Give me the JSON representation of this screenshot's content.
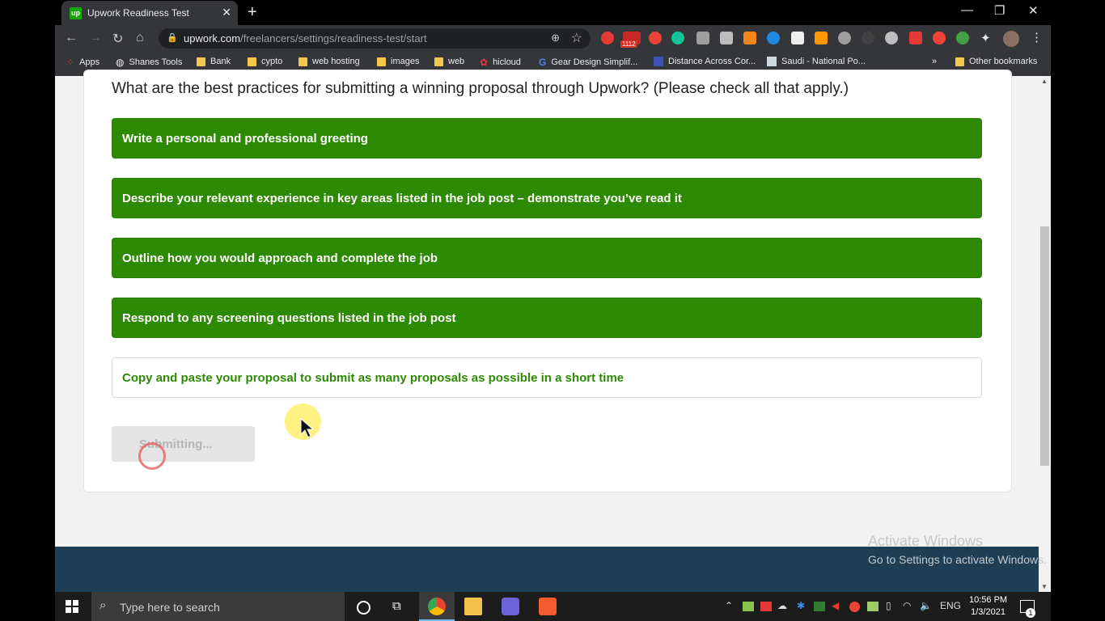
{
  "browser": {
    "tab_title": "Upwork Readiness Test",
    "tab_favicon": "up",
    "url_domain": "upwork.com",
    "url_path": "/freelancers/settings/readiness-test/start",
    "new_tab": "+",
    "bookmarks": [
      {
        "label": "Apps",
        "icon": "apps-grid-icon"
      },
      {
        "label": "Shanes Tools",
        "icon": "globe-icon"
      },
      {
        "label": "Bank",
        "icon": "folder-icon"
      },
      {
        "label": "cypto",
        "icon": "folder-icon"
      },
      {
        "label": "web hosting",
        "icon": "folder-icon"
      },
      {
        "label": "images",
        "icon": "folder-icon"
      },
      {
        "label": "web",
        "icon": "folder-icon"
      },
      {
        "label": "hicloud",
        "icon": "huawei-icon"
      },
      {
        "label": "Gear Design Simplif...",
        "icon": "google-icon"
      },
      {
        "label": "Distance Across Cor...",
        "icon": "page-icon"
      },
      {
        "label": "Saudi - National Po...",
        "icon": "page-icon"
      }
    ],
    "more_bookmarks": "»",
    "other_bookmarks": "Other bookmarks",
    "extension_badge": "1112"
  },
  "question": {
    "text": "What are the best practices for submitting a winning proposal through Upwork? (Please check all that apply.)",
    "options": [
      {
        "label": "Write a personal and professional greeting",
        "selected": true
      },
      {
        "label": "Describe your relevant experience in key areas listed in the job post – demonstrate you’ve read it",
        "selected": true
      },
      {
        "label": "Outline how you would approach and complete the job",
        "selected": true
      },
      {
        "label": "Respond to any screening questions listed in the job post",
        "selected": true
      },
      {
        "label": "Copy and paste your proposal to submit as many proposals as possible in a short time",
        "selected": false
      }
    ],
    "submit_label": "Submitting..."
  },
  "watermark": {
    "line1": "Activate Windows",
    "line2": "Go to Settings to activate Windows."
  },
  "taskbar": {
    "search_placeholder": "Type here to search",
    "language": "ENG",
    "time": "10:56 PM",
    "date": "1/3/2021",
    "notification_count": "1"
  },
  "colors": {
    "upwork_green": "#2e8a05",
    "footer_navy": "#1d3e55"
  }
}
